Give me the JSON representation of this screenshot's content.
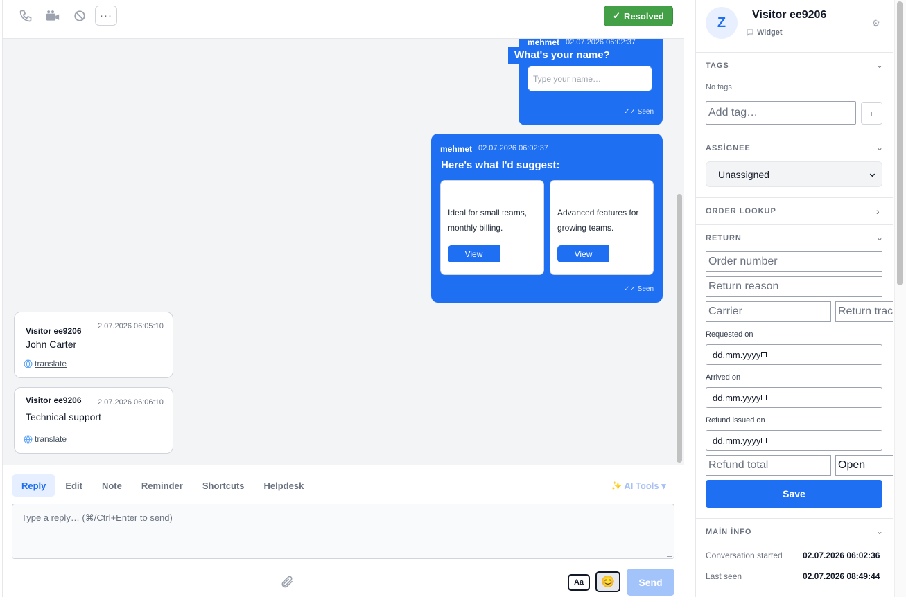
{
  "toolbar": {
    "icons": [
      "phone-icon",
      "video-icon",
      "block-icon"
    ],
    "more_label": "···",
    "resolved_label": "Resolved",
    "resolved_check": "✓"
  },
  "messages": {
    "agent_msg_1": {
      "sender": "mehmet",
      "timestamp": "02.07.2026 06:02:37",
      "question": "What's your name?",
      "input_placeholder": "Type your name…",
      "seen": "✓✓ Seen"
    },
    "agent_msg_2": {
      "sender": "mehmet",
      "timestamp": "02.07.2026 06:02:37",
      "heading": "Here's what I'd suggest:",
      "cards": [
        {
          "desc": "Ideal for small teams, monthly billing.",
          "button": "View"
        },
        {
          "desc": "Advanced features for growing teams.",
          "button": "View"
        }
      ],
      "seen": "✓✓ Seen"
    },
    "visitor_msgs": [
      {
        "sender": "Visitor ee9206",
        "timestamp": "2.07.2026 06:05:10",
        "text": "John Carter",
        "translate": "translate"
      },
      {
        "sender": "Visitor ee9206",
        "timestamp": "2.07.2026 06:06:10",
        "text": "Technical support",
        "translate": "translate"
      }
    ]
  },
  "composer": {
    "tabs": [
      "Reply",
      "Edit",
      "Note",
      "Reminder",
      "Shortcuts",
      "Helpdesk"
    ],
    "active_tab": "Reply",
    "ai_tools": "✨ AI Tools ▾",
    "placeholder": "Type a reply… (⌘/Ctrl+Enter to send)",
    "format_label": "Aa",
    "emoji": "😊",
    "send_label": "Send"
  },
  "sidebar": {
    "avatar_letter": "Z",
    "visitor_name": "Visitor ee9206",
    "channel": "Widget",
    "tags": {
      "title": "TAGS",
      "empty": "No tags",
      "placeholder": "Add tag…",
      "add_label": "+"
    },
    "assignee": {
      "title": "ASSİGNEE",
      "value": "Unassigned"
    },
    "order_lookup": {
      "title": "ORDER LOOKUP"
    },
    "return": {
      "title": "RETURN",
      "order_number": "Order number",
      "return_reason": "Return reason",
      "carrier": "Carrier",
      "return_tracking": "Return trac",
      "requested_on_label": "Requested on",
      "arrived_on_label": "Arrived on",
      "refund_issued_label": "Refund issued on",
      "date_placeholder": "dd.mm.yyyy",
      "refund_total": "Refund total",
      "status": "Open",
      "save_label": "Save"
    },
    "main_info": {
      "title": "MAİN İNFO",
      "rows": [
        {
          "label": "Conversation started",
          "value": "02.07.2026 06:02:36"
        },
        {
          "label": "Last seen",
          "value": "02.07.2026 08:49:44"
        }
      ]
    }
  },
  "colors": {
    "accent": "#1e6ff1",
    "resolved": "#43a047",
    "send_disabled": "#a3c3fb"
  }
}
